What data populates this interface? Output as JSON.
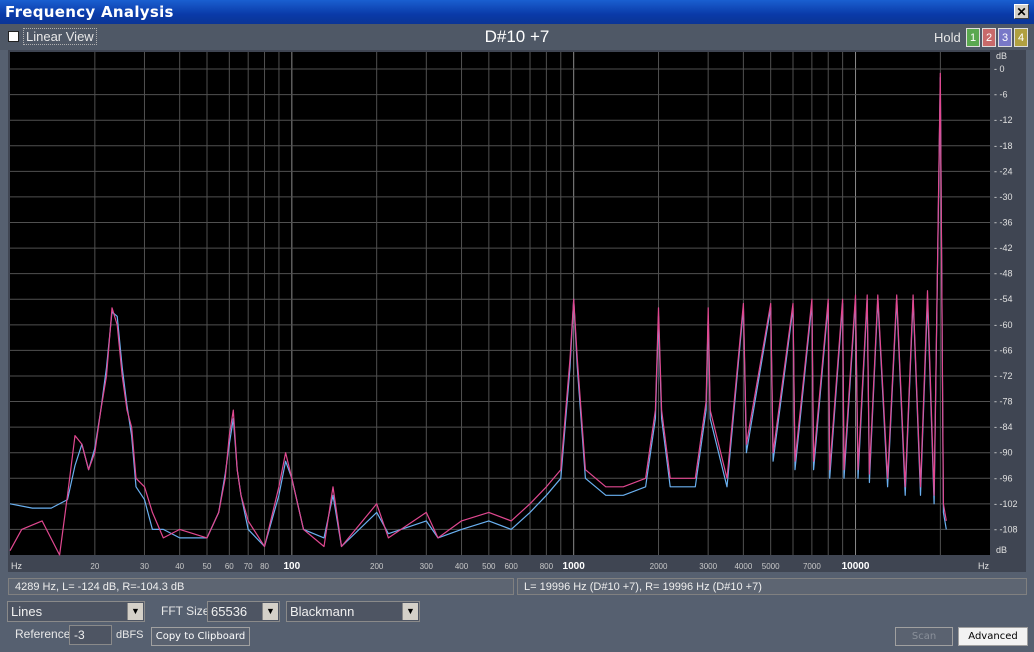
{
  "window": {
    "title": "Frequency Analysis",
    "close_glyph": "✕"
  },
  "toolbar": {
    "linear_view_label": "Linear View",
    "linear_view_checked": false,
    "note_display": "D#10 +7",
    "hold_label": "Hold",
    "hold_buttons": [
      {
        "label": "1",
        "color": "#5aa850"
      },
      {
        "label": "2",
        "color": "#c86a6a"
      },
      {
        "label": "3",
        "color": "#7878c8"
      },
      {
        "label": "4",
        "color": "#b0a040"
      }
    ]
  },
  "chart_data": {
    "type": "line",
    "x_scale": "log",
    "xlim": [
      10,
      30000
    ],
    "ylim": [
      -114,
      4
    ],
    "grid": true,
    "x_unit_label_left": "Hz",
    "x_unit_label_right": "Hz",
    "y_unit_label": "dB",
    "x_ticks": [
      {
        "v": 20,
        "label": "20",
        "major": false
      },
      {
        "v": 30,
        "label": "30",
        "major": false
      },
      {
        "v": 40,
        "label": "40",
        "major": false
      },
      {
        "v": 50,
        "label": "50",
        "major": false
      },
      {
        "v": 60,
        "label": "60",
        "major": false
      },
      {
        "v": 70,
        "label": "70",
        "major": false
      },
      {
        "v": 80,
        "label": "80",
        "major": false
      },
      {
        "v": 100,
        "label": "100",
        "major": true
      },
      {
        "v": 200,
        "label": "200",
        "major": false
      },
      {
        "v": 300,
        "label": "300",
        "major": false
      },
      {
        "v": 400,
        "label": "400",
        "major": false
      },
      {
        "v": 500,
        "label": "500",
        "major": false
      },
      {
        "v": 600,
        "label": "600",
        "major": false
      },
      {
        "v": 800,
        "label": "800",
        "major": false
      },
      {
        "v": 1000,
        "label": "1000",
        "major": true
      },
      {
        "v": 2000,
        "label": "2000",
        "major": false
      },
      {
        "v": 3000,
        "label": "3000",
        "major": false
      },
      {
        "v": 4000,
        "label": "4000",
        "major": false
      },
      {
        "v": 5000,
        "label": "5000",
        "major": false
      },
      {
        "v": 7000,
        "label": "7000",
        "major": false
      },
      {
        "v": 10000,
        "label": "10000",
        "major": true
      }
    ],
    "y_ticks": [
      0,
      -6,
      -12,
      -18,
      -24,
      -30,
      -36,
      -42,
      -48,
      -54,
      -60,
      -66,
      -72,
      -78,
      -84,
      -90,
      -96,
      -102,
      -108
    ],
    "series": [
      {
        "color": "#6ab0f0",
        "points": [
          [
            10,
            -102
          ],
          [
            12,
            -103
          ],
          [
            14,
            -103
          ],
          [
            16,
            -101
          ],
          [
            17,
            -93
          ],
          [
            18,
            -88
          ],
          [
            19,
            -94
          ],
          [
            20,
            -89
          ],
          [
            21,
            -80
          ],
          [
            22,
            -70
          ],
          [
            23,
            -57
          ],
          [
            24,
            -58
          ],
          [
            25,
            -70
          ],
          [
            26,
            -79
          ],
          [
            27,
            -86
          ],
          [
            28,
            -98
          ],
          [
            30,
            -101
          ],
          [
            32,
            -108
          ],
          [
            35,
            -108
          ],
          [
            40,
            -110
          ],
          [
            50,
            -110
          ],
          [
            55,
            -104
          ],
          [
            58,
            -95
          ],
          [
            60,
            -88
          ],
          [
            62,
            -82
          ],
          [
            64,
            -94
          ],
          [
            66,
            -100
          ],
          [
            70,
            -108
          ],
          [
            80,
            -112
          ],
          [
            90,
            -100
          ],
          [
            95,
            -92
          ],
          [
            100,
            -96
          ],
          [
            110,
            -108
          ],
          [
            130,
            -110
          ],
          [
            140,
            -100
          ],
          [
            150,
            -112
          ],
          [
            200,
            -104
          ],
          [
            220,
            -109
          ],
          [
            300,
            -106
          ],
          [
            330,
            -110
          ],
          [
            400,
            -108
          ],
          [
            500,
            -106
          ],
          [
            600,
            -108
          ],
          [
            700,
            -104
          ],
          [
            800,
            -100
          ],
          [
            900,
            -96
          ],
          [
            970,
            -70
          ],
          [
            1000,
            -54
          ],
          [
            1030,
            -70
          ],
          [
            1100,
            -96
          ],
          [
            1300,
            -100
          ],
          [
            1500,
            -100
          ],
          [
            1800,
            -98
          ],
          [
            1950,
            -82
          ],
          [
            2000,
            -58
          ],
          [
            2050,
            -82
          ],
          [
            2200,
            -98
          ],
          [
            2700,
            -98
          ],
          [
            2950,
            -80
          ],
          [
            3000,
            -58
          ],
          [
            3050,
            -82
          ],
          [
            3500,
            -98
          ],
          [
            4000,
            -56
          ],
          [
            4100,
            -90
          ],
          [
            5000,
            -56
          ],
          [
            5100,
            -92
          ],
          [
            6000,
            -56
          ],
          [
            6100,
            -94
          ],
          [
            7000,
            -55
          ],
          [
            7100,
            -94
          ],
          [
            8000,
            -55
          ],
          [
            8100,
            -96
          ],
          [
            9000,
            -55
          ],
          [
            9100,
            -96
          ],
          [
            10000,
            -54
          ],
          [
            10200,
            -96
          ],
          [
            11000,
            -54
          ],
          [
            11200,
            -97
          ],
          [
            12000,
            -54
          ],
          [
            13000,
            -98
          ],
          [
            14000,
            -54
          ],
          [
            15000,
            -100
          ],
          [
            16000,
            -54
          ],
          [
            17000,
            -100
          ],
          [
            18000,
            -54
          ],
          [
            19000,
            -102
          ],
          [
            19996,
            -2
          ],
          [
            20500,
            -104
          ],
          [
            21000,
            -108
          ]
        ]
      },
      {
        "color": "#e04890",
        "points": [
          [
            10,
            -113
          ],
          [
            11,
            -108
          ],
          [
            13,
            -106
          ],
          [
            15,
            -114
          ],
          [
            16,
            -100
          ],
          [
            17,
            -86
          ],
          [
            18,
            -88
          ],
          [
            19,
            -94
          ],
          [
            20,
            -90
          ],
          [
            21,
            -80
          ],
          [
            22,
            -72
          ],
          [
            23,
            -56
          ],
          [
            24,
            -60
          ],
          [
            25,
            -72
          ],
          [
            26,
            -80
          ],
          [
            27,
            -84
          ],
          [
            28,
            -96
          ],
          [
            30,
            -98
          ],
          [
            32,
            -104
          ],
          [
            35,
            -110
          ],
          [
            40,
            -108
          ],
          [
            50,
            -110
          ],
          [
            55,
            -104
          ],
          [
            58,
            -96
          ],
          [
            60,
            -86
          ],
          [
            62,
            -80
          ],
          [
            64,
            -94
          ],
          [
            66,
            -100
          ],
          [
            70,
            -106
          ],
          [
            80,
            -112
          ],
          [
            90,
            -98
          ],
          [
            95,
            -90
          ],
          [
            100,
            -96
          ],
          [
            110,
            -108
          ],
          [
            130,
            -112
          ],
          [
            140,
            -98
          ],
          [
            150,
            -112
          ],
          [
            200,
            -102
          ],
          [
            220,
            -110
          ],
          [
            300,
            -104
          ],
          [
            330,
            -110
          ],
          [
            400,
            -106
          ],
          [
            500,
            -104
          ],
          [
            600,
            -106
          ],
          [
            700,
            -102
          ],
          [
            800,
            -98
          ],
          [
            900,
            -94
          ],
          [
            970,
            -68
          ],
          [
            1000,
            -54
          ],
          [
            1030,
            -68
          ],
          [
            1100,
            -94
          ],
          [
            1300,
            -98
          ],
          [
            1500,
            -98
          ],
          [
            1800,
            -96
          ],
          [
            1950,
            -80
          ],
          [
            2000,
            -56
          ],
          [
            2050,
            -80
          ],
          [
            2200,
            -96
          ],
          [
            2700,
            -96
          ],
          [
            2950,
            -78
          ],
          [
            3000,
            -56
          ],
          [
            3050,
            -80
          ],
          [
            3500,
            -96
          ],
          [
            4000,
            -55
          ],
          [
            4100,
            -88
          ],
          [
            5000,
            -55
          ],
          [
            5100,
            -90
          ],
          [
            6000,
            -55
          ],
          [
            6100,
            -92
          ],
          [
            7000,
            -54
          ],
          [
            7100,
            -92
          ],
          [
            8000,
            -54
          ],
          [
            8100,
            -94
          ],
          [
            9000,
            -54
          ],
          [
            9100,
            -94
          ],
          [
            10000,
            -53
          ],
          [
            10200,
            -94
          ],
          [
            11000,
            -53
          ],
          [
            11200,
            -95
          ],
          [
            12000,
            -53
          ],
          [
            13000,
            -96
          ],
          [
            14000,
            -53
          ],
          [
            15000,
            -98
          ],
          [
            16000,
            -53
          ],
          [
            17000,
            -98
          ],
          [
            18000,
            -52
          ],
          [
            19000,
            -100
          ],
          [
            19996,
            -1
          ],
          [
            20500,
            -102
          ],
          [
            21000,
            -106
          ]
        ]
      }
    ]
  },
  "status": {
    "left": "4289 Hz, L=  -124 dB, R=-104.3 dB",
    "right": "L=  19996 Hz (D#10 +7), R=  19996 Hz (D#10 +7)"
  },
  "controls": {
    "display_mode": "Lines",
    "fft_size_label": "FFT Size",
    "fft_size": "65536",
    "window_function": "Blackmann",
    "reference_label": "Reference",
    "reference_value": "-3",
    "reference_unit": "dBFS",
    "copy_button": "Copy to Clipboard",
    "scan_button": "Scan",
    "advanced_button": "Advanced"
  }
}
